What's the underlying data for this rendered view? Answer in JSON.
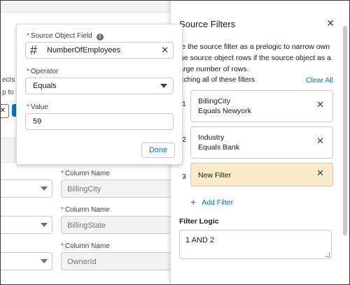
{
  "background": {
    "left_text_1": "ects",
    "left_text_2": "p to f",
    "chip_close": "✕",
    "columns": [
      {
        "label": "Column Name",
        "value": "BillingCity"
      },
      {
        "label": "Column Name",
        "value": "BillingState"
      },
      {
        "label": "Column Name",
        "value": "OwnerId"
      }
    ]
  },
  "popover": {
    "source_field_label": "Source Object Field",
    "source_field_value": "NumberOfEmployees",
    "operator_label": "Operator",
    "operator_value": "Equals",
    "value_label": "Value",
    "value_value": "59",
    "done_label": "Done"
  },
  "panel": {
    "title": "Source Filters",
    "description": "se the source filter as a prelogic to narrow own the source object rows if the source object as a large number of rows.",
    "match_label": "atching all of these filters",
    "clear_all": "Clear All",
    "filters": [
      {
        "number": "1",
        "field": "BillingCity",
        "condition": "Equals Newyork"
      },
      {
        "number": "2",
        "field": "Industry",
        "condition": "Equals Bank"
      },
      {
        "number": "3",
        "field": "New Filter",
        "condition": ""
      }
    ],
    "add_filter": "Add Filter",
    "logic_label": "Filter Logic",
    "logic_value": "1 AND 2"
  },
  "colors": {
    "brand": "#0176d3",
    "required": "#c23934",
    "new_filter_bg": "#faebc9"
  }
}
